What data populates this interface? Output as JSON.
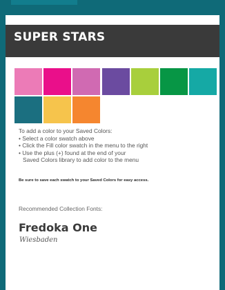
{
  "header": {
    "title": "SUPER STARS"
  },
  "swatches": [
    {
      "color": "#ec7bb7",
      "name": "pink"
    },
    {
      "color": "#ea0f8a",
      "name": "magenta"
    },
    {
      "color": "#d06ab2",
      "name": "orchid"
    },
    {
      "color": "#6b4ba0",
      "name": "purple"
    },
    {
      "color": "#a8cf3c",
      "name": "lime"
    },
    {
      "color": "#079645",
      "name": "green"
    },
    {
      "color": "#15a9a5",
      "name": "teal"
    },
    {
      "color": "#1b6f80",
      "name": "deep-teal"
    },
    {
      "color": "#f6c44c",
      "name": "yellow"
    },
    {
      "color": "#f5862f",
      "name": "orange"
    }
  ],
  "instructions": {
    "intro": "To add a color to your Saved Colors:",
    "step1": "• Select a color swatch above",
    "step2": "• Click the Fill color swatch in the menu to the right",
    "step3a": "• Use the plus (+) found at the end of your",
    "step3b": "Saved Colors library to add color to the menu"
  },
  "tip": "Be sure to save each swatch to your Saved Colors for easy access.",
  "fonts": {
    "label": "Recommended Collection Fonts:",
    "primary": "Fredoka One",
    "secondary": "Wiesbaden"
  }
}
